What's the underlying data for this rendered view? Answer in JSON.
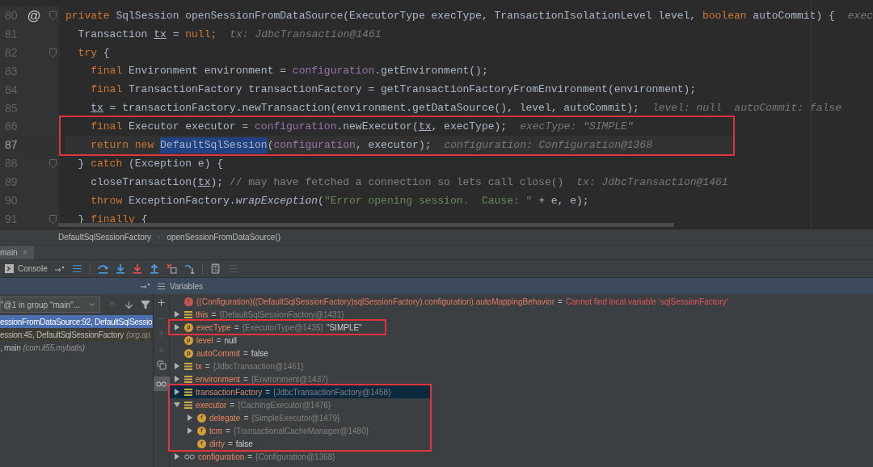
{
  "editor": {
    "lines": [
      {
        "number": "80",
        "gutter_mark": "@",
        "fold": true,
        "current": false,
        "boxed": false,
        "tokens": [
          {
            "kind": "keyword",
            "text": "private"
          },
          {
            "kind": "plain",
            "text": " SqlSession openSessionFromDataSource(ExecutorType execType, TransactionIsolationLevel level, "
          },
          {
            "kind": "keyword",
            "text": "boolean"
          },
          {
            "kind": "plain",
            "text": " autoCommit) {"
          },
          {
            "kind": "hint",
            "text": "exec"
          }
        ]
      },
      {
        "number": "81",
        "fold": false,
        "current": false,
        "boxed": false,
        "tokens": [
          {
            "kind": "plain",
            "text": "  Transaction "
          },
          {
            "kind": "local",
            "text": "tx"
          },
          {
            "kind": "plain",
            "text": " = "
          },
          {
            "kind": "keyword",
            "text": "null;"
          },
          {
            "kind": "hint",
            "text": "tx: JdbcTransaction@1461"
          }
        ]
      },
      {
        "number": "82",
        "fold": true,
        "current": false,
        "boxed": false,
        "tokens": [
          {
            "kind": "keyword",
            "text": "  try"
          },
          {
            "kind": "plain",
            "text": " {"
          }
        ]
      },
      {
        "number": "83",
        "fold": false,
        "current": false,
        "boxed": false,
        "tokens": [
          {
            "kind": "keyword",
            "text": "    final"
          },
          {
            "kind": "plain",
            "text": " Environment environment = "
          },
          {
            "kind": "field",
            "text": "configuration"
          },
          {
            "kind": "plain",
            "text": ".getEnvironment();"
          }
        ]
      },
      {
        "number": "84",
        "fold": false,
        "current": false,
        "boxed": false,
        "tokens": [
          {
            "kind": "keyword",
            "text": "    final"
          },
          {
            "kind": "plain",
            "text": " TransactionFactory transactionFactory = getTransactionFactoryFromEnvironment(environment);"
          }
        ]
      },
      {
        "number": "85",
        "fold": false,
        "current": false,
        "boxed": false,
        "tokens": [
          {
            "kind": "local",
            "text": "    tx"
          },
          {
            "kind": "plain",
            "text": " = transactionFactory.newTransaction(environment.getDataSource(), level, autoCommit);"
          },
          {
            "kind": "hint",
            "text": "level: null  autoCommit: false"
          }
        ]
      },
      {
        "number": "86",
        "fold": false,
        "current": false,
        "boxed": true,
        "tokens": [
          {
            "kind": "keyword",
            "text": "    final"
          },
          {
            "kind": "plain",
            "text": " Executor executor = "
          },
          {
            "kind": "field",
            "text": "configuration"
          },
          {
            "kind": "plain",
            "text": ".newExecutor("
          },
          {
            "kind": "local",
            "text": "tx"
          },
          {
            "kind": "plain",
            "text": ", execType);"
          },
          {
            "kind": "hint",
            "text": "execType: \"SIMPLE\""
          }
        ]
      },
      {
        "number": "87",
        "fold": false,
        "current": true,
        "boxed": true,
        "tokens": [
          {
            "kind": "keyword",
            "text": "    return new "
          },
          {
            "kind": "selection",
            "text": "DefaultSqlSession"
          },
          {
            "kind": "plain",
            "text": "("
          },
          {
            "kind": "field",
            "text": "configuration"
          },
          {
            "kind": "plain",
            "text": ", executor);"
          },
          {
            "kind": "hint",
            "text": "configuration: Configuration@1368"
          }
        ]
      },
      {
        "number": "88",
        "fold": true,
        "current": false,
        "boxed": false,
        "tokens": [
          {
            "kind": "plain",
            "text": "  } "
          },
          {
            "kind": "keyword",
            "text": "catch"
          },
          {
            "kind": "plain",
            "text": " (Exception e) {"
          }
        ]
      },
      {
        "number": "89",
        "fold": false,
        "current": false,
        "boxed": false,
        "tokens": [
          {
            "kind": "plain",
            "text": "    closeTransaction("
          },
          {
            "kind": "local",
            "text": "tx"
          },
          {
            "kind": "plain",
            "text": "); "
          },
          {
            "kind": "comment",
            "text": "// may have fetched a connection so lets call close()"
          },
          {
            "kind": "hint",
            "text": "tx: JdbcTransaction@1461"
          }
        ]
      },
      {
        "number": "90",
        "fold": false,
        "current": false,
        "boxed": false,
        "tokens": [
          {
            "kind": "keyword",
            "text": "    throw"
          },
          {
            "kind": "plain",
            "text": " ExceptionFactory."
          },
          {
            "kind": "method",
            "text": "wrapException"
          },
          {
            "kind": "plain",
            "text": "("
          },
          {
            "kind": "string",
            "text": "\"Error opening session.  Cause: \""
          },
          {
            "kind": "plain",
            "text": " + e, e);"
          }
        ]
      },
      {
        "number": "91",
        "fold": true,
        "current": false,
        "boxed": false,
        "tokens": [
          {
            "kind": "plain",
            "text": "  } "
          },
          {
            "kind": "keyword",
            "text": "finally"
          },
          {
            "kind": "plain",
            "text": " {"
          }
        ]
      }
    ]
  },
  "breadcrumbs": {
    "items": [
      "DefaultSqlSessionFactory",
      "openSessionFromDataSource()"
    ],
    "separator": "›"
  },
  "debug_tab": {
    "label": "main",
    "close": "×"
  },
  "toolbar": {
    "console_label": "Console"
  },
  "variables_header": {
    "title": "Variables"
  },
  "frames": {
    "thread": "\"@1 in group \"main\"...",
    "items": [
      {
        "text": "essionFromDataSource:92, DefaultSqlSessio",
        "selected": true
      },
      {
        "text": "ession:45, DefaultSqlSessionFactory",
        "package": "(org.ap",
        "selected": false
      },
      {
        "text": ", main",
        "package": "(com.it55.mybatis)",
        "selected": false
      }
    ]
  },
  "variables": [
    {
      "kind": "error",
      "badge": "!",
      "name": "((Configuration)((DefaultSqlSessionFactory)sqlSessionFactory).configuration).autoMappingBehavior",
      "separator": "=",
      "error": "Cannot find local variable 'sqlSessionFactory'",
      "selected": false,
      "boxed": false
    },
    {
      "kind": "object",
      "name": "this",
      "separator": "=",
      "type": "{DefaultSqlSessionFactory@1431}",
      "expanded": false,
      "selected": false,
      "boxed": false
    },
    {
      "kind": "param",
      "badge": "p",
      "name": "execType",
      "separator": "=",
      "type": "{ExecutorType@1435}",
      "value": "\"SIMPLE\"",
      "expanded": false,
      "selected": false,
      "boxed": true
    },
    {
      "kind": "param",
      "badge": "p",
      "name": "level",
      "separator": "=",
      "value": "null",
      "selected": false,
      "boxed": false
    },
    {
      "kind": "param",
      "badge": "p",
      "name": "autoCommit",
      "separator": "=",
      "value": "false",
      "selected": false,
      "boxed": false
    },
    {
      "kind": "object",
      "name": "tx",
      "separator": "=",
      "type": "{JdbcTransaction@1461}",
      "expanded": false,
      "selected": false,
      "boxed": false
    },
    {
      "kind": "object",
      "name": "environment",
      "separator": "=",
      "type": "{Environment@1437}",
      "expanded": false,
      "selected": false,
      "boxed": false
    },
    {
      "kind": "object",
      "name": "transactionFactory",
      "separator": "=",
      "type": "{JdbcTransactionFactory@1458}",
      "expanded": false,
      "selected": true,
      "boxed": true
    },
    {
      "kind": "object",
      "name": "executor",
      "separator": "=",
      "type": "{CachingExecutor@1476}",
      "expanded": true,
      "selected": false,
      "boxed": true,
      "children": [
        {
          "kind": "field",
          "badge": "f",
          "name": "delegate",
          "separator": "=",
          "type": "{SimpleExecutor@1479}",
          "expanded": false,
          "selected": false,
          "boxed": true
        },
        {
          "kind": "field",
          "badge": "f",
          "name": "tcm",
          "separator": "=",
          "type": "{TransactionalCacheManager@1480}",
          "expanded": false,
          "selected": false,
          "boxed": true
        },
        {
          "kind": "field",
          "badge": "f",
          "name": "dirty",
          "separator": "=",
          "value": "false",
          "selected": false,
          "boxed": true
        }
      ]
    },
    {
      "kind": "watch",
      "name": "configuration",
      "separator": "=",
      "type": "{Configuration@1368}",
      "expanded": false,
      "selected": false,
      "boxed": false
    }
  ]
}
